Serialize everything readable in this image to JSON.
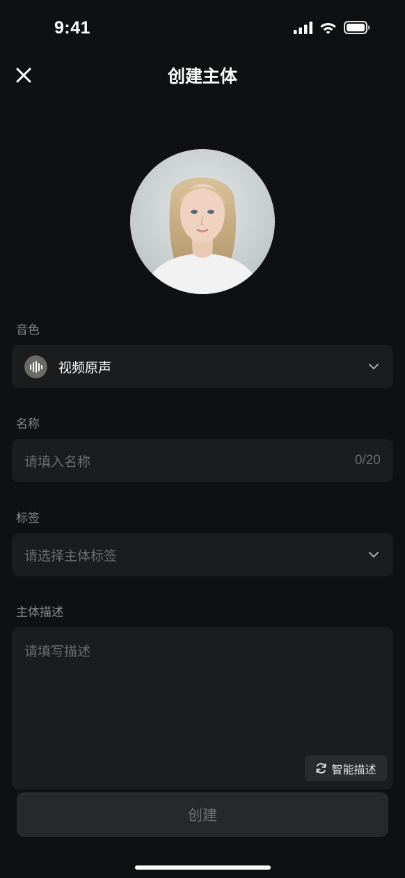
{
  "status_bar": {
    "time": "9:41",
    "icons": [
      "cellular-signal-icon",
      "wifi-icon",
      "battery-icon"
    ]
  },
  "header": {
    "title": "创建主体",
    "close_icon": "close-icon"
  },
  "voice": {
    "label": "音色",
    "value": "视频原声"
  },
  "name": {
    "label": "名称",
    "placeholder": "请填入名称",
    "counter": "0/20"
  },
  "tags": {
    "label": "标签",
    "placeholder": "请选择主体标签"
  },
  "description": {
    "label": "主体描述",
    "placeholder": "请填写描述",
    "smart_button": "智能描述"
  },
  "create_button": "创建",
  "colors": {
    "background": "#0f1011",
    "field": "#1b1c1e",
    "muted_text": "#6a6b6e",
    "label_text": "#8a8b8d"
  }
}
